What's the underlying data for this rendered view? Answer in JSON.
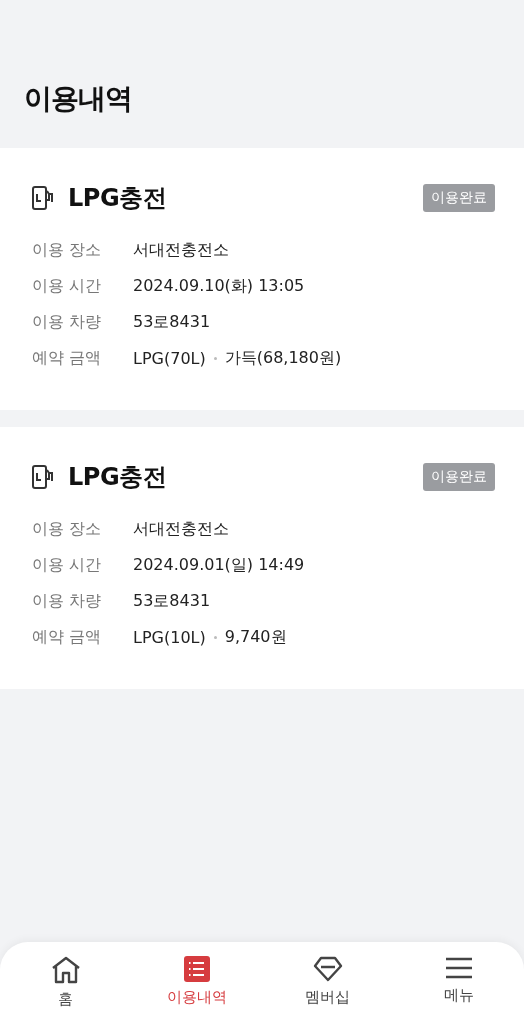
{
  "page_title": "이용내역",
  "records": [
    {
      "title": "LPG충전",
      "status": "이용완료",
      "fields": [
        {
          "label": "이용 장소",
          "parts": [
            "서대전충전소"
          ]
        },
        {
          "label": "이용 시간",
          "parts": [
            "2024.09.10(화) 13:05"
          ]
        },
        {
          "label": "이용 차량",
          "parts": [
            "53로8431"
          ]
        },
        {
          "label": "예약 금액",
          "parts": [
            "LPG(70L)",
            "가득(68,180원)"
          ]
        }
      ]
    },
    {
      "title": "LPG충전",
      "status": "이용완료",
      "fields": [
        {
          "label": "이용 장소",
          "parts": [
            "서대전충전소"
          ]
        },
        {
          "label": "이용 시간",
          "parts": [
            "2024.09.01(일) 14:49"
          ]
        },
        {
          "label": "이용 차량",
          "parts": [
            "53로8431"
          ]
        },
        {
          "label": "예약 금액",
          "parts": [
            "LPG(10L)",
            "9,740원"
          ]
        }
      ]
    }
  ],
  "nav": [
    {
      "kind": "home",
      "label": "홈",
      "selected": false
    },
    {
      "kind": "list",
      "label": "이용내역",
      "selected": true
    },
    {
      "kind": "gem",
      "label": "멤버십",
      "selected": false
    },
    {
      "kind": "menu",
      "label": "메뉴",
      "selected": false
    }
  ]
}
